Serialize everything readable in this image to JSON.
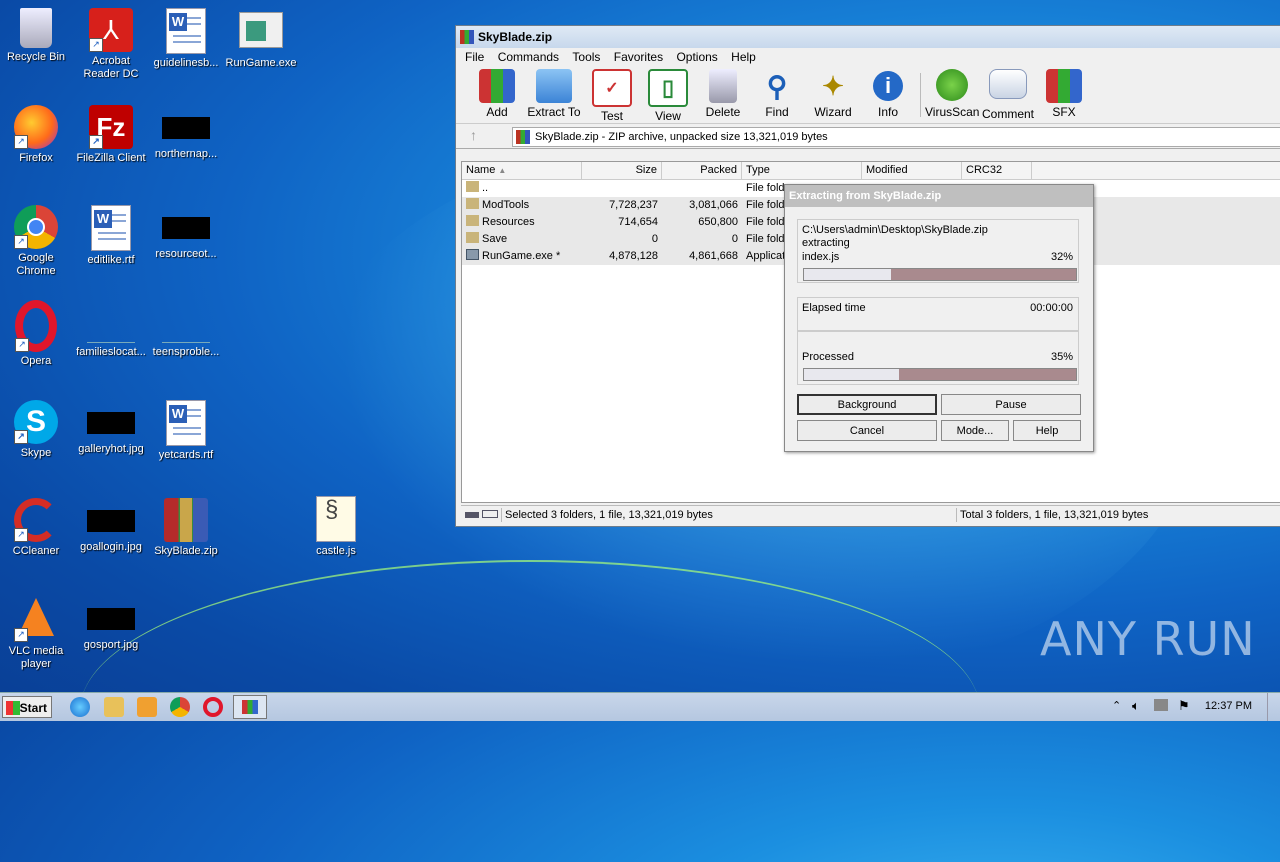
{
  "desktop": {
    "icons": [
      {
        "label": "Recycle Bin",
        "icon": "recycle-bin-icon"
      },
      {
        "label": "Acrobat Reader DC",
        "icon": "acrobat-icon"
      },
      {
        "label": "guidelinesb...",
        "icon": "word-doc-icon"
      },
      {
        "label": "RunGame.exe",
        "icon": "exe-icon"
      },
      {
        "label": "Firefox",
        "icon": "firefox-icon"
      },
      {
        "label": "FileZilla Client",
        "icon": "filezilla-icon"
      },
      {
        "label": "northernap...",
        "icon": "black-thumbnail"
      },
      {
        "label": "Google Chrome",
        "icon": "chrome-icon"
      },
      {
        "label": "editlike.rtf",
        "icon": "word-doc-icon"
      },
      {
        "label": "resourceot...",
        "icon": "black-thumbnail"
      },
      {
        "label": "Opera",
        "icon": "opera-icon"
      },
      {
        "label": "familieslocat...",
        "icon": "blank-thumbnail"
      },
      {
        "label": "teensproble...",
        "icon": "blank-thumbnail"
      },
      {
        "label": "Skype",
        "icon": "skype-icon"
      },
      {
        "label": "galleryhot.jpg",
        "icon": "black-thumbnail"
      },
      {
        "label": "yetcards.rtf",
        "icon": "word-doc-icon"
      },
      {
        "label": "CCleaner",
        "icon": "ccleaner-icon"
      },
      {
        "label": "goallogin.jpg",
        "icon": "black-thumbnail"
      },
      {
        "label": "SkyBlade.zip",
        "icon": "winrar-icon"
      },
      {
        "label": "castle.js",
        "icon": "script-icon"
      },
      {
        "label": "VLC media player",
        "icon": "vlc-icon"
      },
      {
        "label": "gosport.jpg",
        "icon": "black-thumbnail"
      }
    ]
  },
  "winrar": {
    "title": "SkyBlade.zip",
    "menu": [
      "File",
      "Commands",
      "Tools",
      "Favorites",
      "Options",
      "Help"
    ],
    "toolbar": [
      "Add",
      "Extract To",
      "Test",
      "View",
      "Delete",
      "Find",
      "Wizard",
      "Info",
      "VirusScan",
      "Comment",
      "SFX"
    ],
    "address": "SkyBlade.zip - ZIP archive, unpacked size 13,321,019 bytes",
    "columns": [
      "Name",
      "Size",
      "Packed",
      "Type",
      "Modified",
      "CRC32"
    ],
    "rows": [
      {
        "name": "..",
        "size": "",
        "packed": "",
        "type": "File fold"
      },
      {
        "name": "ModTools",
        "size": "7,728,237",
        "packed": "3,081,066",
        "type": "File fold"
      },
      {
        "name": "Resources",
        "size": "714,654",
        "packed": "650,800",
        "type": "File fold"
      },
      {
        "name": "Save",
        "size": "0",
        "packed": "0",
        "type": "File fold"
      },
      {
        "name": "RunGame.exe *",
        "size": "4,878,128",
        "packed": "4,861,668",
        "type": "Applicat"
      }
    ],
    "status_left": "Selected 3 folders, 1 file, 13,321,019 bytes",
    "status_right": "Total 3 folders, 1 file, 13,321,019 bytes"
  },
  "dialog": {
    "title": "Extracting from SkyBlade.zip",
    "path": "C:\\Users\\admin\\Desktop\\SkyBlade.zip",
    "action": "extracting",
    "file": "index.js",
    "file_percent": "32%",
    "file_progress": 0.32,
    "elapsed_label": "Elapsed time",
    "elapsed_value": "00:00:00",
    "processed_label": "Processed",
    "processed_percent": "35%",
    "processed_progress": 0.35,
    "buttons": {
      "background": "Background",
      "pause": "Pause",
      "cancel": "Cancel",
      "mode": "Mode...",
      "help": "Help"
    }
  },
  "taskbar": {
    "start_label": "Start",
    "clock": "12:37 PM"
  },
  "watermark": "ANY RUN"
}
